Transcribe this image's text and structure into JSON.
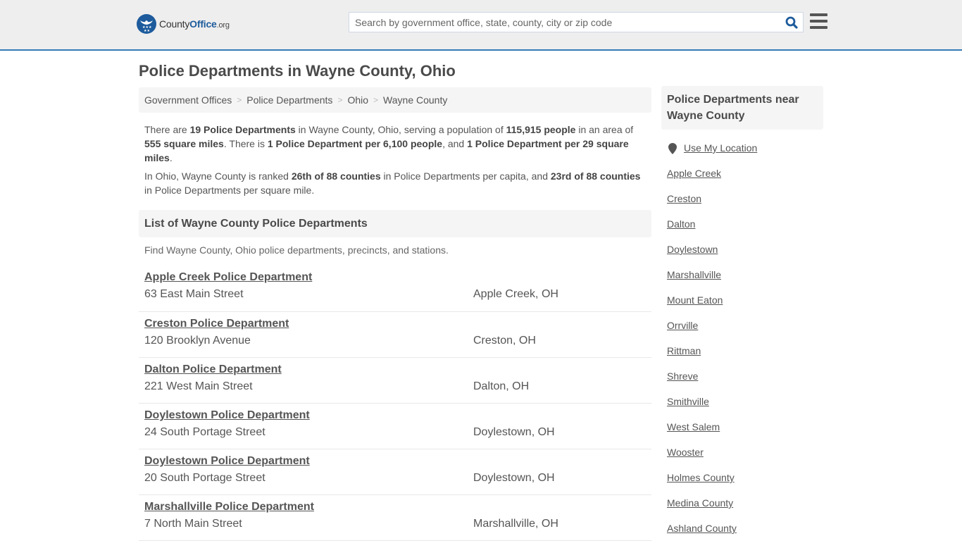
{
  "header": {
    "logo": {
      "prefix": "County",
      "brand": "Office",
      "tld": ".org"
    },
    "search": {
      "placeholder": "Search by government office, state, county, city or zip code",
      "value": ""
    },
    "icons": {
      "search": "search-icon",
      "menu": "hamburger-menu-icon",
      "logo": "county-office-eagle-logo-icon"
    },
    "accent_color": "#337ab7"
  },
  "page": {
    "title": "Police Departments in Wayne County, Ohio",
    "breadcrumb": [
      {
        "label": "Government Offices"
      },
      {
        "label": "Police Departments"
      },
      {
        "label": "Ohio"
      },
      {
        "label": "Wayne County"
      }
    ],
    "intro": {
      "p1": {
        "t1": "There are ",
        "b1": "19 Police Departments",
        "t2": " in Wayne County, Ohio, serving a population of ",
        "b2": "115,915 people",
        "t3": " in an area of ",
        "b3": "555 square miles",
        "t4": ". There is ",
        "b4": "1 Police Department per 6,100 people",
        "t5": ", and ",
        "b5": "1 Police Department per 29 square miles",
        "t6": "."
      },
      "p2": {
        "t1": "In Ohio, Wayne County is ranked ",
        "b1": "26th of 88 counties",
        "t2": " in Police Departments per capita, and ",
        "b2": "23rd of 88 counties",
        "t3": " in Police Departments per square mile."
      }
    },
    "list_section": {
      "title": "List of Wayne County Police Departments",
      "description": "Find Wayne County, Ohio police departments, precincts, and stations."
    },
    "departments": [
      {
        "name": "Apple Creek Police Department",
        "address": "63 East Main Street",
        "city": "Apple Creek, OH"
      },
      {
        "name": "Creston Police Department",
        "address": "120 Brooklyn Avenue",
        "city": "Creston, OH"
      },
      {
        "name": "Dalton Police Department",
        "address": "221 West Main Street",
        "city": "Dalton, OH"
      },
      {
        "name": "Doylestown Police Department",
        "address": "24 South Portage Street",
        "city": "Doylestown, OH"
      },
      {
        "name": "Doylestown Police Department",
        "address": "20 South Portage Street",
        "city": "Doylestown, OH"
      },
      {
        "name": "Marshallville Police Department",
        "address": "7 North Main Street",
        "city": "Marshallville, OH"
      }
    ]
  },
  "sidebar": {
    "title": "Police Departments near Wayne County",
    "use_location": "Use My Location",
    "links": [
      {
        "label": "Apple Creek"
      },
      {
        "label": "Creston"
      },
      {
        "label": "Dalton"
      },
      {
        "label": "Doylestown"
      },
      {
        "label": "Marshallville"
      },
      {
        "label": "Mount Eaton"
      },
      {
        "label": "Orrville"
      },
      {
        "label": "Rittman"
      },
      {
        "label": "Shreve"
      },
      {
        "label": "Smithville"
      },
      {
        "label": "West Salem"
      },
      {
        "label": "Wooster"
      },
      {
        "label": "Holmes County"
      },
      {
        "label": "Medina County"
      },
      {
        "label": "Ashland County"
      }
    ]
  }
}
